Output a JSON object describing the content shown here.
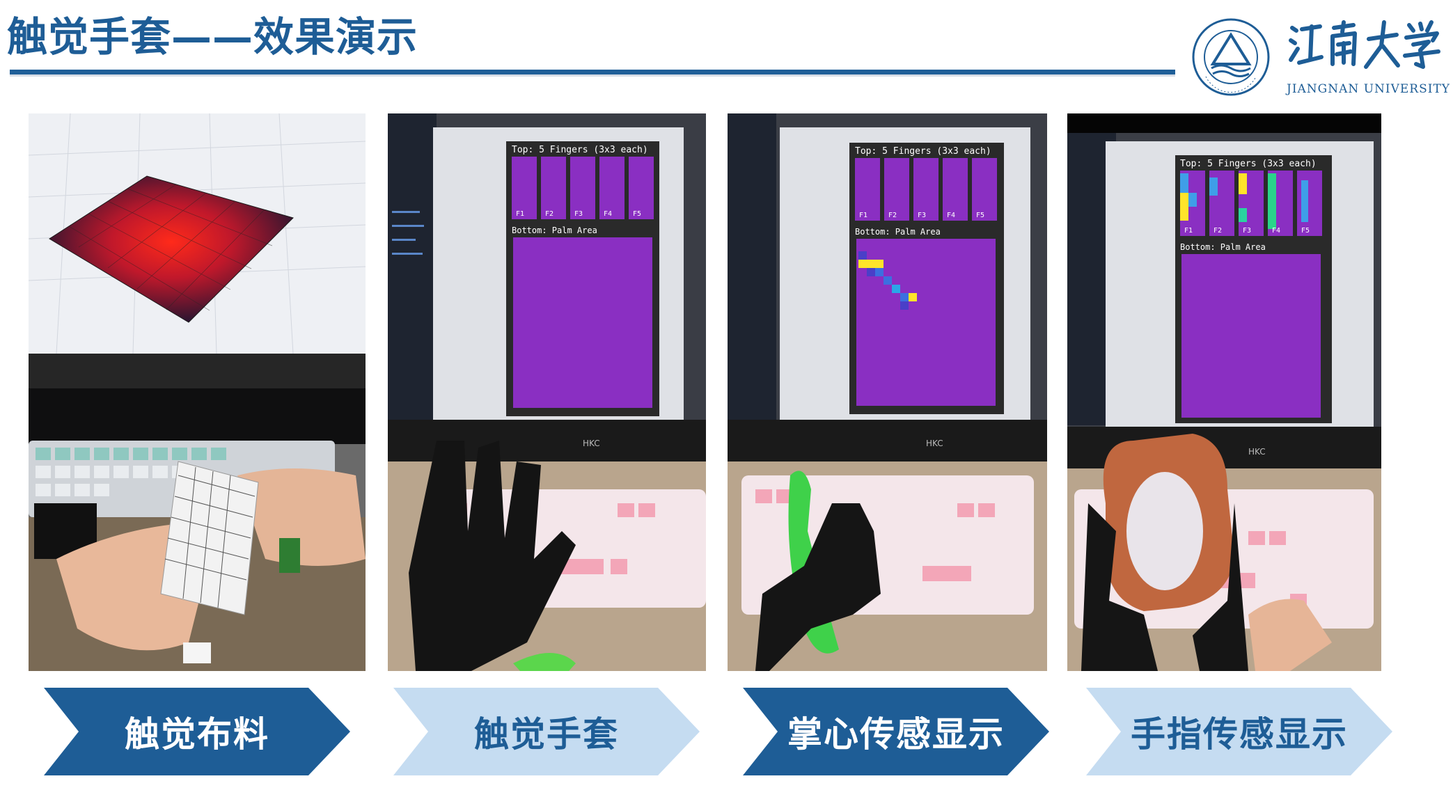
{
  "slide": {
    "title": "触觉手套——效果演示",
    "brand_color": "#1e5d96",
    "light_chevron_color": "#c5dcf1"
  },
  "logo": {
    "name_cn": "江南大学",
    "name_en": "JIANGNAN UNIVERSITY"
  },
  "panels": [
    {
      "label": "触觉布料",
      "style": "dark"
    },
    {
      "label": "触觉手套",
      "style": "light"
    },
    {
      "label": "掌心传感显示",
      "style": "dark"
    },
    {
      "label": "手指传感显示",
      "style": "light"
    }
  ],
  "screens": {
    "top_label": "Top: 5 Fingers (3x3 each)",
    "bottom_label": "Bottom: Palm Area",
    "finger_labels": [
      "F1",
      "F2",
      "F3",
      "F4",
      "F5"
    ],
    "monitor_brand": "HKC"
  }
}
